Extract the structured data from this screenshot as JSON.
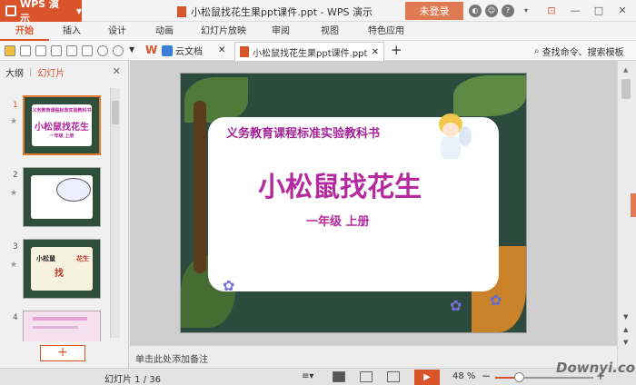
{
  "titlebar": {
    "app_name": "WPS 演示",
    "doc_title": "小松鼠找花生果ppt课件.ppt - WPS 演示",
    "login_label": "未登录",
    "icons": [
      "skin-icon",
      "feedback-icon",
      "help-icon",
      "menu-icon"
    ],
    "window_buttons": [
      "minimize-icon",
      "maximize-icon",
      "close-icon"
    ]
  },
  "menubar": {
    "items": [
      "开始",
      "插入",
      "设计",
      "动画",
      "幻灯片放映",
      "审阅",
      "视图",
      "特色应用"
    ],
    "active_index": 0
  },
  "toolbar": {
    "cloud_label": "云文档",
    "doc_tab_label": "小松鼠找花生果ppt课件.ppt",
    "search_label": "查找命令、搜索模板"
  },
  "left_panel": {
    "tab_outline": "大纲",
    "tab_slides": "幻灯片",
    "slide_numbers": [
      "1",
      "2",
      "3",
      "4"
    ],
    "thumb1_title": "小松鼠找花生",
    "thumb1_subject": "义务教育课程标准实验教科书",
    "thumb1_grade": "一年级 上册",
    "thumb3_word1": "小松鼠",
    "thumb3_word2": "找",
    "thumb3_word3": "花生",
    "add_label": "+"
  },
  "slide": {
    "subject": "义务教育课程标准实验教科书",
    "title": "小松鼠找花生",
    "grade": "一年级 上册"
  },
  "notes": {
    "placeholder": "单击此处添加备注"
  },
  "statusbar": {
    "slide_count": "幻灯片 1 / 36",
    "zoom_label": "48 %",
    "zoom_level": 0.48,
    "play_icon": "play-icon"
  },
  "watermark": "Downyi.com"
}
